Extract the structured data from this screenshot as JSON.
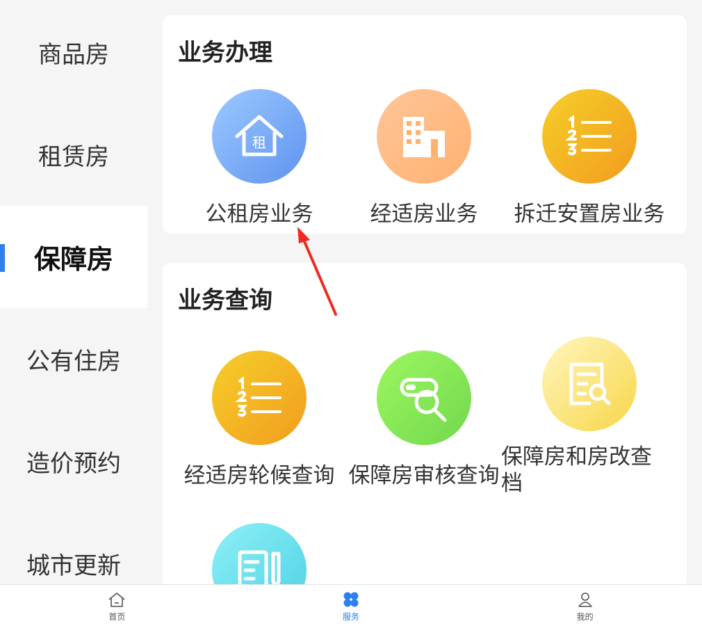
{
  "sidebar": {
    "items": [
      {
        "label": "商品房"
      },
      {
        "label": "租赁房"
      },
      {
        "label": "保障房"
      },
      {
        "label": "公有住房"
      },
      {
        "label": "造价预约"
      },
      {
        "label": "城市更新"
      }
    ],
    "active_index": 2,
    "accent_color": "#2f80ed"
  },
  "sections": {
    "business": {
      "title": "业务办理",
      "tiles": [
        {
          "label": "公租房业务",
          "icon": "house-rent-icon",
          "icon_text": "租"
        },
        {
          "label": "经适房业务",
          "icon": "building-icon"
        },
        {
          "label": "拆迁安置房业务",
          "icon": "numbered-list-icon"
        }
      ]
    },
    "query": {
      "title": "业务查询",
      "tiles": [
        {
          "label": "经适房轮候查询",
          "icon": "numbered-list-icon"
        },
        {
          "label": "保障房审核查询",
          "icon": "search-review-icon"
        },
        {
          "label": "保障房和房改查档",
          "icon": "document-search-icon"
        },
        {
          "label": "",
          "icon": "document-pen-icon"
        }
      ]
    }
  },
  "bottom_nav": {
    "items": [
      {
        "label": "首页",
        "icon": "home-icon"
      },
      {
        "label": "服务",
        "icon": "service-grid-icon"
      },
      {
        "label": "我的",
        "icon": "user-icon"
      }
    ],
    "active_index": 1
  }
}
